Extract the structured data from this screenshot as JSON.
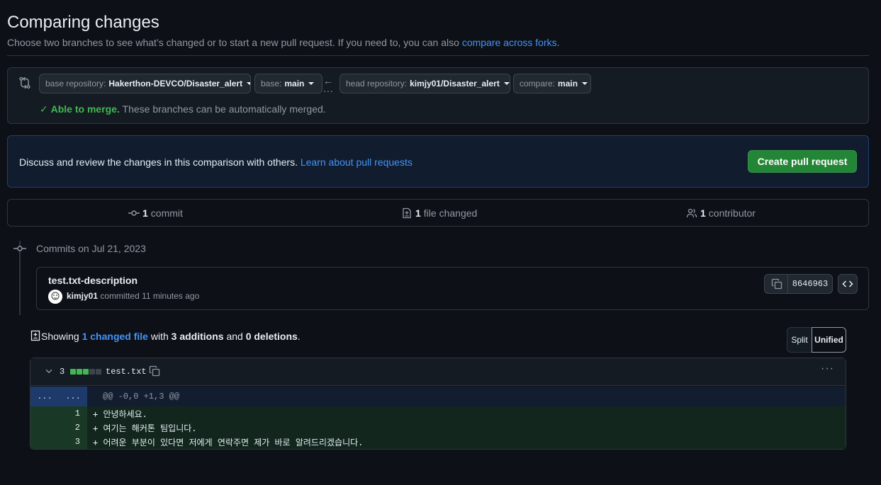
{
  "header": {
    "title": "Comparing changes",
    "subtitle": "Choose two branches to see what’s changed or to start a new pull request. If you need to, you can also",
    "subtitle_link": "compare across forks",
    "subtitle_end": "."
  },
  "range": {
    "base_repo_label": "base repository:",
    "base_repo_value": "Hakerthon-DEVCO/Disaster_alert",
    "base_label": "base:",
    "base_value": "main",
    "head_repo_label": "head repository:",
    "head_repo_value": "kimjy01/Disaster_alert",
    "compare_label": "compare:",
    "compare_value": "main",
    "merge_ok": "Able to merge.",
    "merge_msg": "These branches can be automatically merged."
  },
  "banner": {
    "text": "Discuss and review the changes in this comparison with others.",
    "link": "Learn about pull requests",
    "button": "Create pull request"
  },
  "summary": {
    "commits_count": "1",
    "commits_label": "commit",
    "files_count": "1",
    "files_label": "file changed",
    "contributors_count": "1",
    "contributors_label": "contributor"
  },
  "commits": {
    "date_heading": "Commits on Jul 21, 2023",
    "items": [
      {
        "title": "test.txt-description",
        "author": "kimjy01",
        "meta": "committed 11 minutes ago",
        "sha": "8646963"
      }
    ]
  },
  "diff_toolbar": {
    "showing": "Showing",
    "changed_files": "1 changed file",
    "with": "with",
    "additions": "3 additions",
    "and": "and",
    "deletions": "0 deletions",
    "period": ".",
    "split_label": "Split",
    "unified_label": "Unified",
    "active_view": "Unified"
  },
  "file": {
    "additions": "3",
    "name": "test.txt",
    "diffstat": [
      "added",
      "added",
      "added",
      "neutral",
      "neutral"
    ],
    "hunk_old_gutter": "...",
    "hunk_new_gutter": "...",
    "hunk_header": "@@ -0,0 +1,3 @@",
    "lines": [
      {
        "num": "1",
        "code": "+ 안녕하세요."
      },
      {
        "num": "2",
        "code": "+ 여기는 해커톤 팀입니다."
      },
      {
        "num": "3",
        "code": "+ 어려운 부분이 있다면 저에게 연락주면 제가 바로 알려드리겠습니다."
      }
    ]
  },
  "colors": {
    "accent_link": "#4493f8",
    "success": "#3fb950",
    "primary_button": "#238636",
    "added_line_bg": "#12261e",
    "hunk_bg": "#121d2f"
  }
}
